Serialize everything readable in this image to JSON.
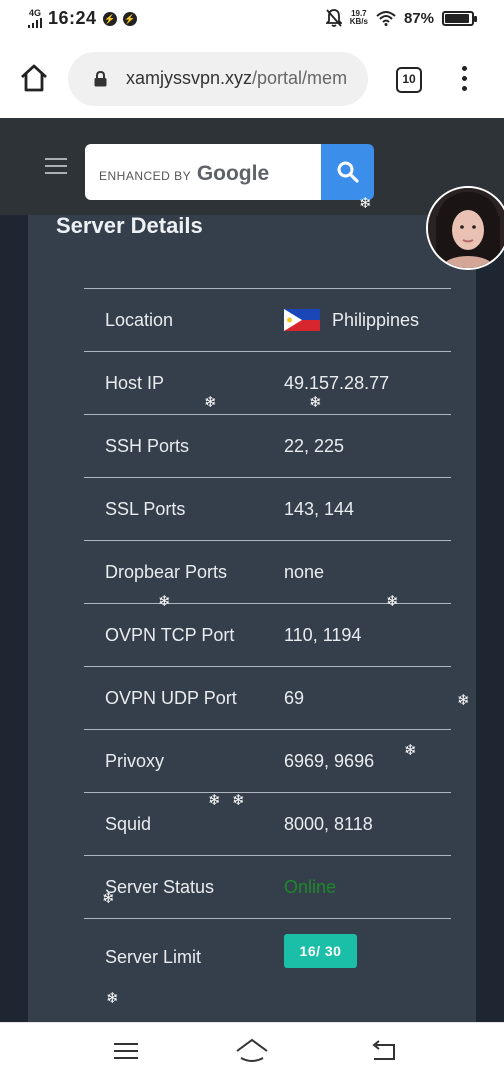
{
  "status_bar": {
    "network": "4G",
    "time": "16:24",
    "app_icons": [
      "messenger-icon",
      "messenger-icon"
    ],
    "net_speed_value": "19.7",
    "net_speed_unit": "KB/s",
    "battery_text": "87%",
    "battery_level": 0.87
  },
  "browser": {
    "url_domain": "xamjyssvpn.xyz",
    "url_path": "/portal/mem",
    "tab_count": "10"
  },
  "search": {
    "enhanced_label": "ENHANCED BY",
    "brand": "Google"
  },
  "server_details": {
    "title": "Server Details",
    "rows": [
      {
        "label": "Location",
        "value": "Philippines"
      },
      {
        "label": "Host IP",
        "value": "49.157.28.77"
      },
      {
        "label": "SSH Ports",
        "value": "22, 225"
      },
      {
        "label": "SSL Ports",
        "value": "143, 144"
      },
      {
        "label": "Dropbear Ports",
        "value": "none"
      },
      {
        "label": "OVPN TCP Port",
        "value": "110, 1194"
      },
      {
        "label": "OVPN UDP Port",
        "value": "69"
      },
      {
        "label": "Privoxy",
        "value": "6969, 9696"
      },
      {
        "label": "Squid",
        "value": "8000, 8118"
      },
      {
        "label": "Server Status",
        "value": "Online"
      }
    ],
    "limit": {
      "label": "Server Limit",
      "value": "16/ 30"
    }
  },
  "colors": {
    "header_bg": "#2e3338",
    "card_bg": "#353f4b",
    "search_button": "#3b8eea",
    "status_online": "#1c8a2a",
    "limit_badge": "#1bbfa7"
  }
}
